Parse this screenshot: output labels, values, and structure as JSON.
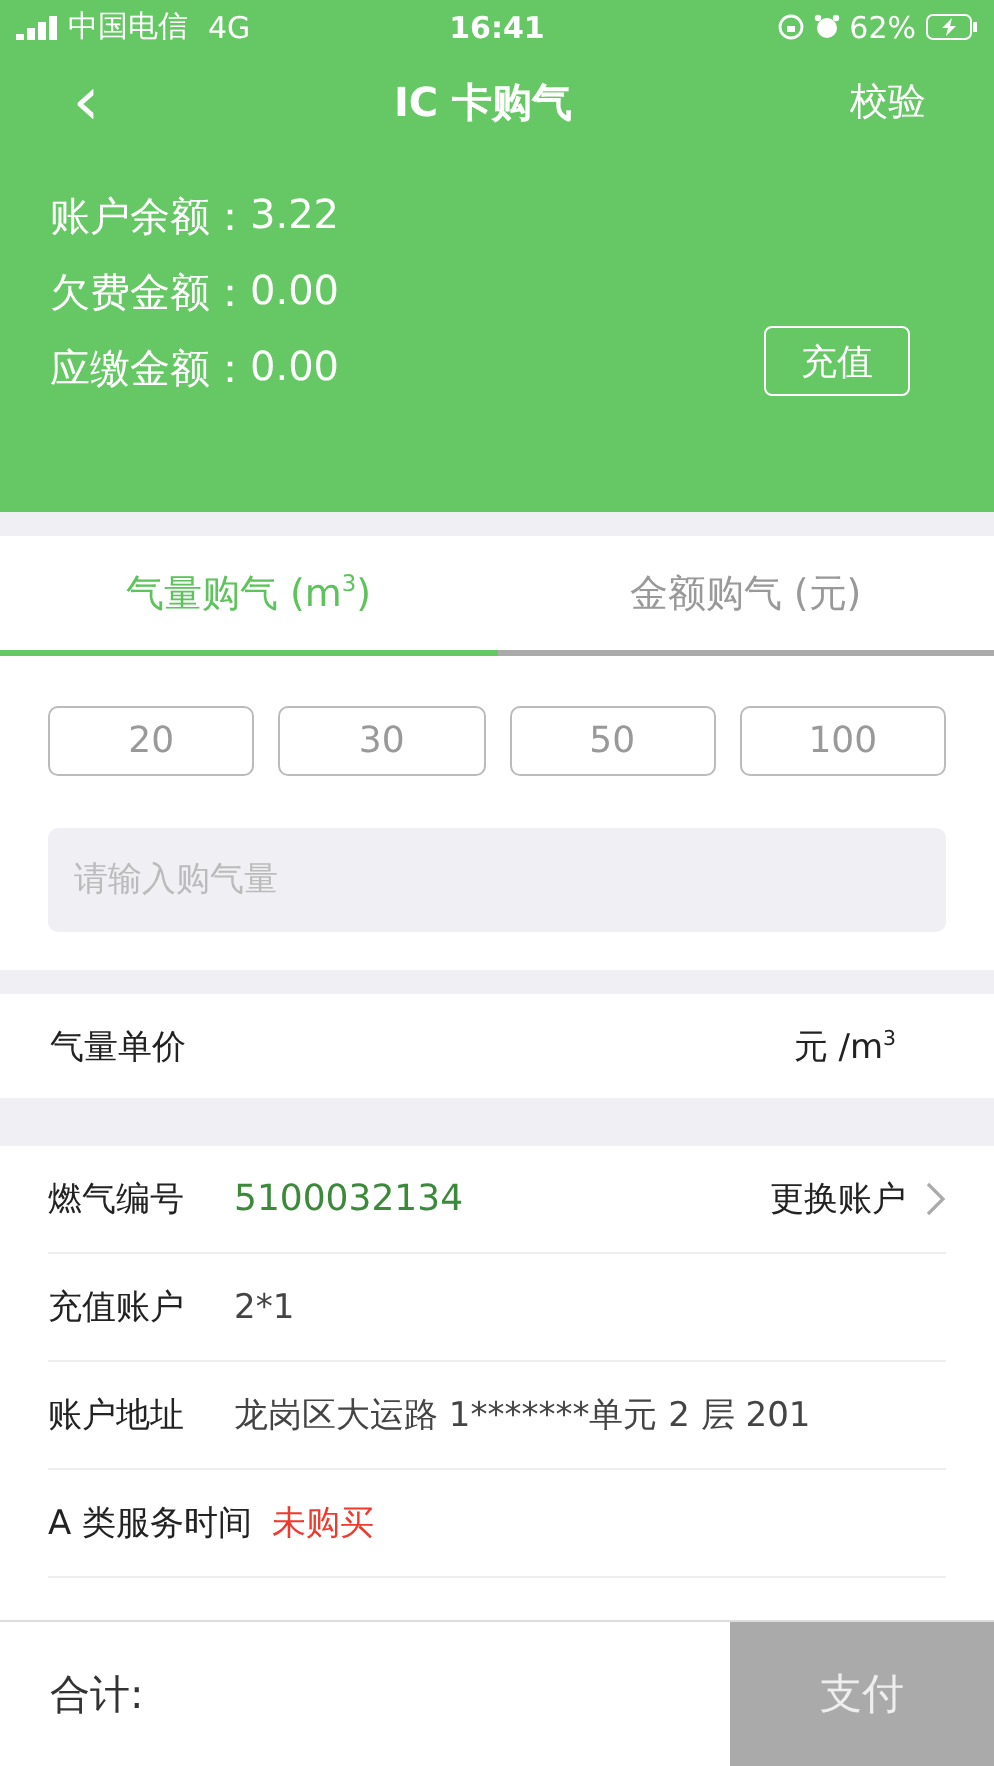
{
  "status_bar": {
    "carrier": "中国电信",
    "network": "4G",
    "time": "16:41",
    "battery": "62%"
  },
  "nav": {
    "back": "‹",
    "title": "IC 卡购气",
    "action": "校验"
  },
  "balances": [
    {
      "label": "账户余额：",
      "value": "3.22"
    },
    {
      "label": "欠费金额：",
      "value": "0.00"
    },
    {
      "label": "应缴金额：",
      "value": "0.00"
    }
  ],
  "recharge_button": "充值",
  "tabs": [
    {
      "label": "气量购气 (m$^{3}$)",
      "selected": true
    },
    {
      "label": "金额购气 (元)",
      "selected": false
    }
  ],
  "quick_amounts": [
    "20",
    "30",
    "50",
    "100"
  ],
  "amount_input": {
    "placeholder": "请输入购气量"
  },
  "unit_price": {
    "label": "气量单价",
    "unit": "元 /m$^{3}$"
  },
  "details": [
    {
      "kind": "link",
      "label": "燃气编号",
      "value": "5100032134",
      "action": "更换账户"
    },
    {
      "kind": "plain",
      "label": "充值账户",
      "value": "2*1"
    },
    {
      "kind": "plain",
      "label": "账户地址",
      "value": "龙岗区大运路 1*******单元 2 层 201"
    },
    {
      "kind": "warning",
      "label": "A 类服务时间",
      "value": "未购买"
    }
  ],
  "footer": {
    "total_label": "合计:",
    "pay_button": "支付"
  }
}
